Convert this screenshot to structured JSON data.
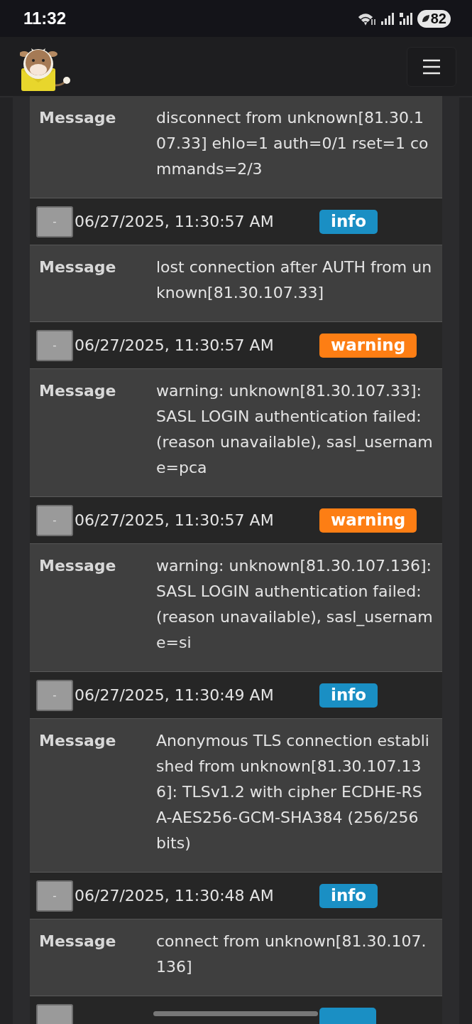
{
  "status_bar": {
    "time": "11:32",
    "battery": "82"
  },
  "entries": [
    {
      "message_label": "Message",
      "message": "disconnect from unknown[81.30.107.33] ehlo=1 auth=0/1 rset=1 commands=2/3"
    },
    {
      "toggle": "-",
      "time": "06/27/2025, 11:30:57 AM",
      "badge": {
        "kind": "info",
        "label": "info"
      },
      "message_label": "Message",
      "message": "lost connection after AUTH from unknown[81.30.107.33]"
    },
    {
      "toggle": "-",
      "time": "06/27/2025, 11:30:57 AM",
      "badge": {
        "kind": "warning",
        "label": "warning"
      },
      "message_label": "Message",
      "message": "warning: unknown[81.30.107.33]: SASL LOGIN authentication failed: (reason unavailable), sasl_username=pca"
    },
    {
      "toggle": "-",
      "time": "06/27/2025, 11:30:57 AM",
      "badge": {
        "kind": "warning",
        "label": "warning"
      },
      "message_label": "Message",
      "message": "warning: unknown[81.30.107.136]: SASL LOGIN authentication failed: (reason unavailable), sasl_username=si"
    },
    {
      "toggle": "-",
      "time": "06/27/2025, 11:30:49 AM",
      "badge": {
        "kind": "info",
        "label": "info"
      },
      "message_label": "Message",
      "message": "Anonymous TLS connection established from unknown[81.30.107.136]: TLSv1.2 with cipher ECDHE-RSA-AES256-GCM-SHA384 (256/256 bits)"
    },
    {
      "toggle": "-",
      "time": "06/27/2025, 11:30:48 AM",
      "badge": {
        "kind": "info",
        "label": "info"
      },
      "message_label": "Message",
      "message": "connect from unknown[81.30.107.136]"
    },
    {
      "badge": {
        "kind": "info"
      }
    }
  ]
}
